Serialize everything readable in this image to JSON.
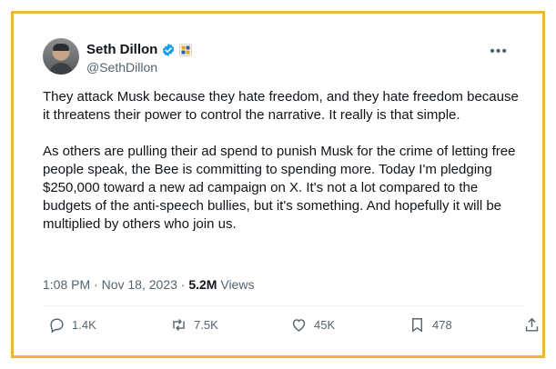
{
  "author": {
    "name": "Seth Dillon",
    "handle": "@SethDillon",
    "verified_color": "#1d9bf0"
  },
  "menu_icon": "more-icon",
  "tweet": {
    "paragraphs": [
      "They attack Musk because they hate freedom, and they hate freedom because it threatens their power to control the narrative. It really is that simple.",
      "As others are pulling their ad spend to punish Musk for the crime of letting free people speak, the Bee is committing to spending more. Today I'm pledging $250,000 toward a new ad campaign on X. It's not a lot compared to the budgets of the anti-speech bullies, but it's something. And hopefully it will be multiplied by others who join us."
    ],
    "time": "1:08 PM",
    "date": "Nov 18, 2023",
    "separator": "·",
    "views_count": "5.2M",
    "views_label": "Views"
  },
  "actions": {
    "replies": "1.4K",
    "reposts": "7.5K",
    "likes": "45K",
    "bookmarks": "478"
  },
  "colors": {
    "frame_border": "#f2b33a",
    "muted_text": "#536471",
    "primary_text": "#0f1419"
  }
}
